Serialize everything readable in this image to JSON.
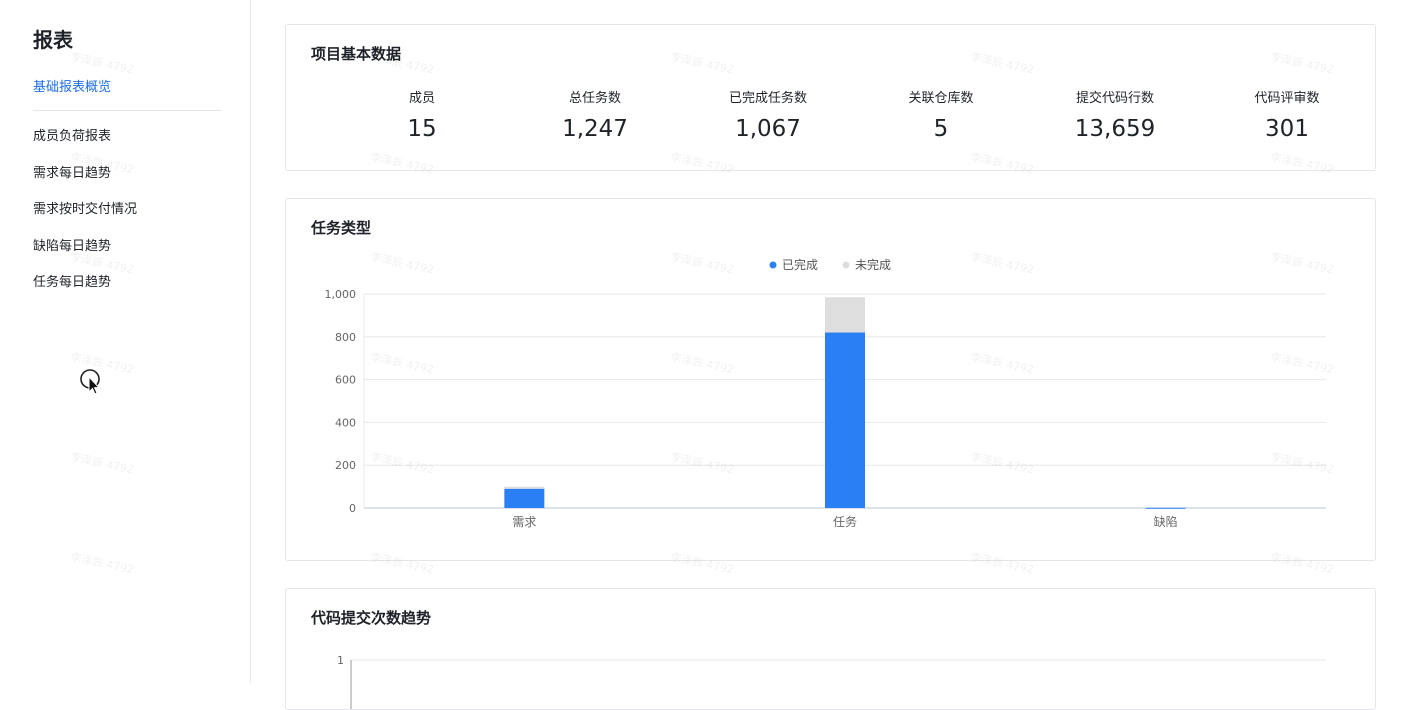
{
  "sidebar": {
    "title": "报表",
    "active_item": "基础报表概览",
    "items": [
      "成员负荷报表",
      "需求每日趋势",
      "需求按时交付情况",
      "缺陷每日趋势",
      "任务每日趋势"
    ]
  },
  "basic_stats": {
    "title": "项目基本数据",
    "items": [
      {
        "label": "成员",
        "value": "15"
      },
      {
        "label": "总任务数",
        "value": "1,247"
      },
      {
        "label": "已完成任务数",
        "value": "1,067"
      },
      {
        "label": "关联仓库数",
        "value": "5"
      },
      {
        "label": "提交代码行数",
        "value": "13,659"
      },
      {
        "label": "代码评审数",
        "value": "301"
      }
    ]
  },
  "task_type": {
    "title": "任务类型",
    "chart_data": {
      "type": "bar",
      "stacked": true,
      "categories": [
        "需求",
        "任务",
        "缺陷"
      ],
      "series": [
        {
          "name": "已完成",
          "color": "#2b7ff5",
          "values": [
            90,
            820,
            1
          ]
        },
        {
          "name": "未完成",
          "color": "#dedede",
          "values": [
            10,
            165,
            0
          ]
        }
      ],
      "yticks": [
        "0",
        "200",
        "400",
        "600",
        "800",
        "1,000"
      ],
      "ylim": [
        0,
        1000
      ],
      "legend": "top-center",
      "grid": true
    }
  },
  "code_commits": {
    "title": "代码提交次数趋势",
    "chart_data": {
      "type": "line",
      "yticks": [
        "1"
      ],
      "ylim": [
        0,
        1
      ],
      "grid": true
    }
  },
  "watermark": {
    "text": "李泽辰 4792"
  },
  "colors": {
    "accent": "#1e6fe8",
    "completed": "#2b7ff5",
    "incomplete": "#dedede"
  }
}
